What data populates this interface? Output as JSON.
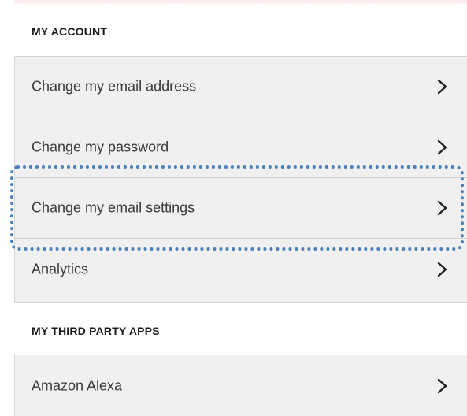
{
  "account": {
    "heading": "MY ACCOUNT",
    "items": [
      {
        "label": "Change my email address",
        "icon": "chevron-right-icon"
      },
      {
        "label": "Change my password",
        "icon": "chevron-right-icon"
      },
      {
        "label": "Change my email settings",
        "icon": "chevron-right-icon",
        "highlighted": true
      },
      {
        "label": "Analytics",
        "icon": "chevron-right-icon"
      }
    ]
  },
  "third_party": {
    "heading": "MY THIRD PARTY APPS",
    "items": [
      {
        "label": "Amazon Alexa",
        "icon": "chevron-right-icon"
      }
    ]
  },
  "colors": {
    "highlight_border": "#4b7fb8",
    "row_background": "#f0f0f0",
    "divider": "#d4d4d4"
  }
}
